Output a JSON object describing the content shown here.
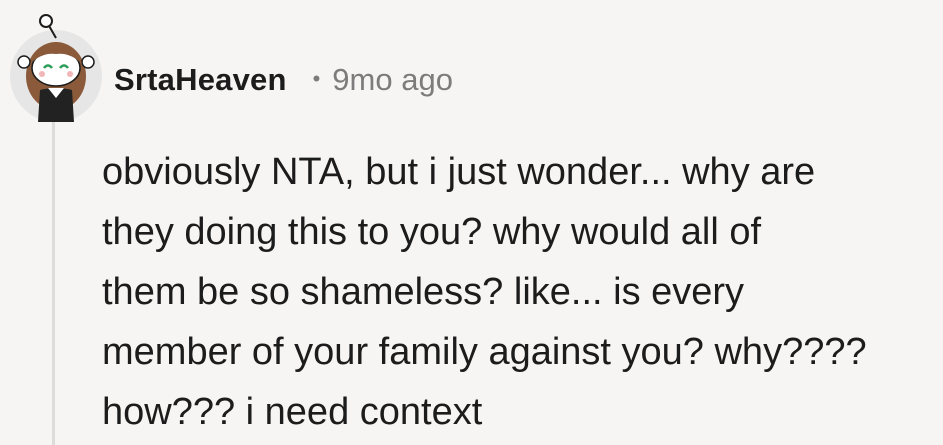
{
  "comment": {
    "author": "SrtaHeaven",
    "separator": "•",
    "timestamp": "9mo ago",
    "avatar_icon": "snoo-avatar-icon",
    "body_lines": [
      "obviously NTA, but i just wonder... why are",
      "they doing this to you? why would all of",
      "them be so shameless? like... is every",
      "member of your family against you? why????",
      "how??? i need context"
    ]
  }
}
